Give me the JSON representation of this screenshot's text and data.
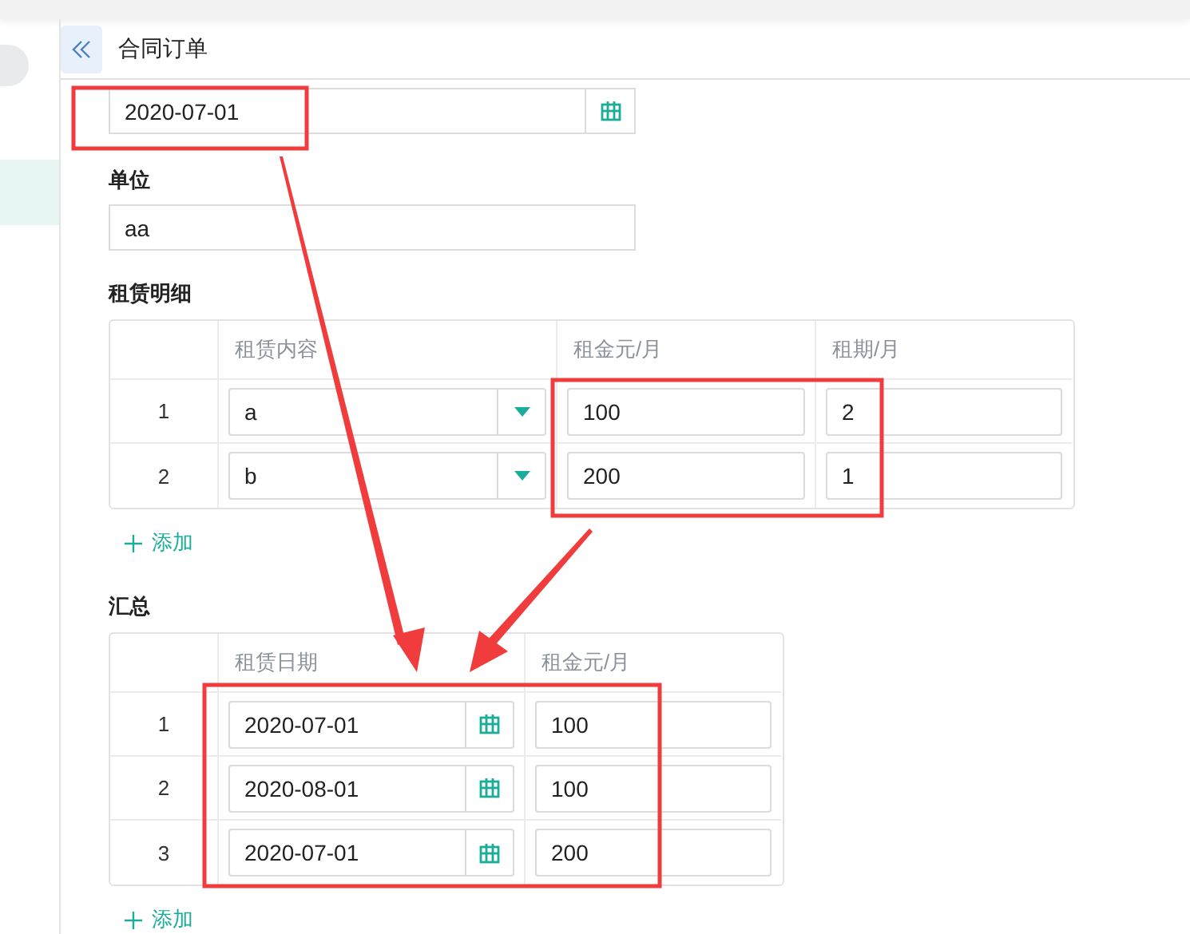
{
  "header": {
    "title": "合同订单"
  },
  "date_field": {
    "value": "2020-07-01"
  },
  "unit": {
    "label": "单位",
    "value": "aa"
  },
  "rental_details": {
    "title": "租赁明细",
    "columns": [
      "租赁内容",
      "租金元/月",
      "租期/月"
    ],
    "rows": [
      {
        "index": "1",
        "content": "a",
        "rent": "100",
        "term": "2"
      },
      {
        "index": "2",
        "content": "b",
        "rent": "200",
        "term": "1"
      }
    ],
    "add_label": "添加"
  },
  "summary": {
    "title": "汇总",
    "columns": [
      "租赁日期",
      "租金元/月"
    ],
    "rows": [
      {
        "index": "1",
        "date": "2020-07-01",
        "rent": "100"
      },
      {
        "index": "2",
        "date": "2020-08-01",
        "rent": "100"
      },
      {
        "index": "3",
        "date": "2020-07-01",
        "rent": "200"
      }
    ],
    "add_label": "添加"
  }
}
